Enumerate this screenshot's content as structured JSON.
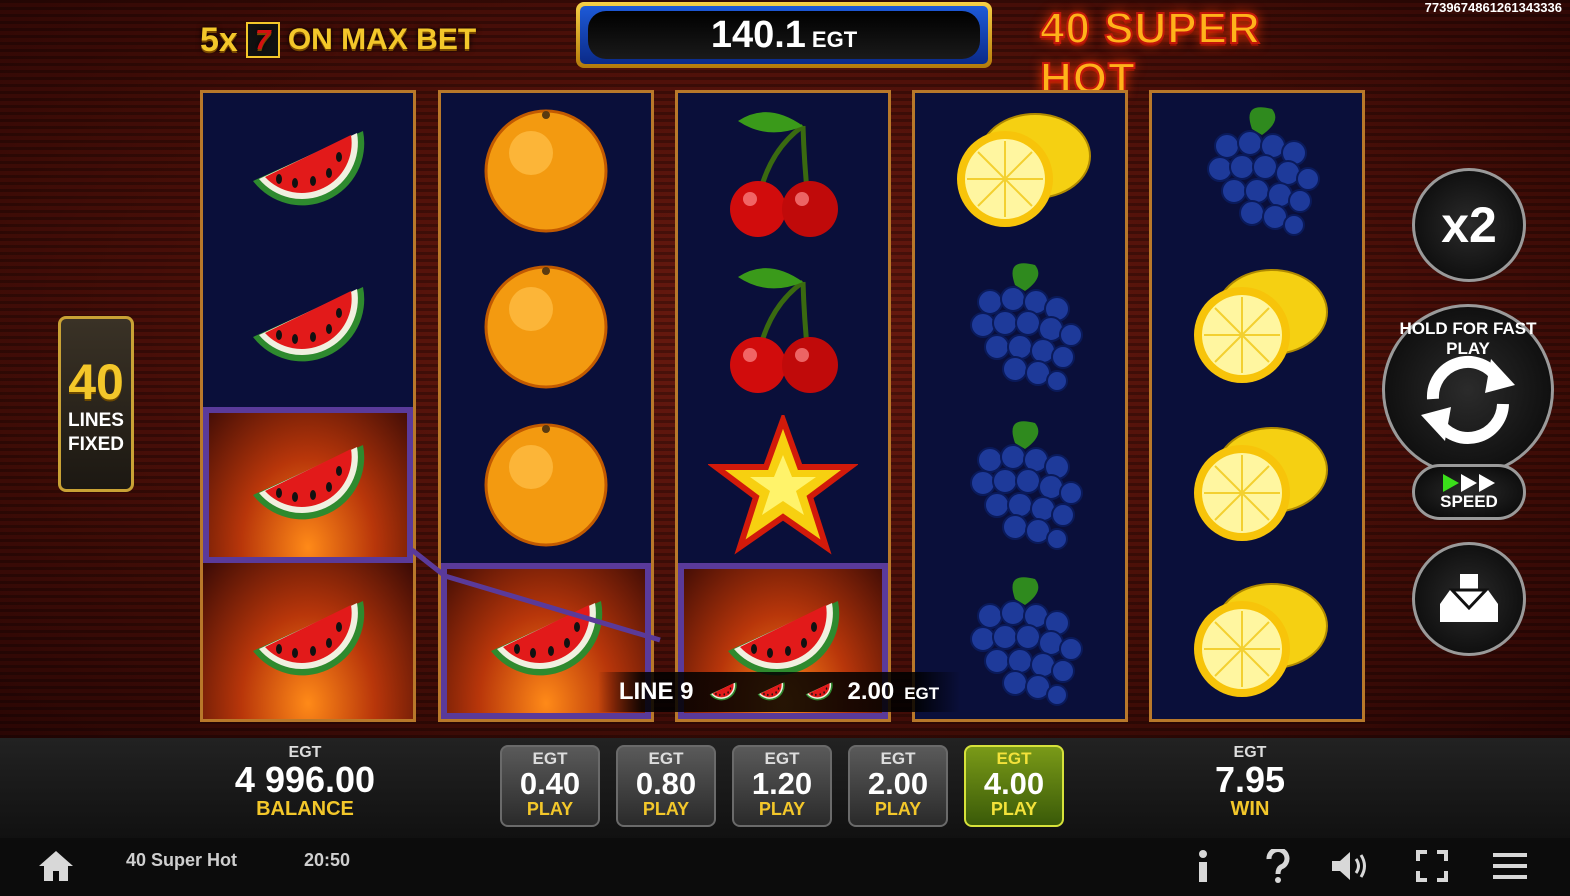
{
  "header": {
    "promo_multiplier": "5x",
    "promo_symbol": "7",
    "promo_text": "ON MAX BET",
    "jackpot_value": "140.1",
    "jackpot_currency": "EGT",
    "game_logo": "40 SUPER HOT",
    "ticket_id": "7739674861261343336"
  },
  "lines_badge": {
    "count": "40",
    "line1": "LINES",
    "line2": "FIXED"
  },
  "reels": [
    [
      "watermelon",
      "watermelon",
      "watermelon",
      "watermelon"
    ],
    [
      "orange",
      "orange",
      "orange",
      "watermelon"
    ],
    [
      "cherry",
      "cherry",
      "star",
      "watermelon"
    ],
    [
      "lemon",
      "grapes",
      "grapes",
      "grapes"
    ],
    [
      "grapes",
      "lemon",
      "lemon",
      "lemon"
    ]
  ],
  "win_line": {
    "label": "LINE 9",
    "symbol": "watermelon",
    "symbol_count": 3,
    "amount": "2.00",
    "currency": "EGT"
  },
  "controls": {
    "multiplier_label": "x2",
    "spin_hint": "HOLD FOR FAST PLAY",
    "speed_label": "SPEED",
    "icons": [
      "refresh-icon",
      "fast-forward-icon",
      "collect-icon"
    ]
  },
  "balance": {
    "currency": "EGT",
    "value": "4 996.00",
    "label": "BALANCE"
  },
  "win": {
    "currency": "EGT",
    "value": "7.95",
    "label": "WIN"
  },
  "bets": [
    {
      "currency": "EGT",
      "value": "0.40",
      "label": "PLAY",
      "selected": false
    },
    {
      "currency": "EGT",
      "value": "0.80",
      "label": "PLAY",
      "selected": false
    },
    {
      "currency": "EGT",
      "value": "1.20",
      "label": "PLAY",
      "selected": false
    },
    {
      "currency": "EGT",
      "value": "2.00",
      "label": "PLAY",
      "selected": false
    },
    {
      "currency": "EGT",
      "value": "4.00",
      "label": "PLAY",
      "selected": true
    }
  ],
  "footer": {
    "game_title": "40 Super Hot",
    "clock": "20:50",
    "icons": [
      "home-icon",
      "info-icon",
      "help-icon",
      "sound-icon",
      "fullscreen-icon",
      "menu-icon"
    ]
  },
  "colors": {
    "accent_gold": "#f3c72a",
    "selected_bet": "#7a9a18",
    "reel_bg": "#0a0f3a"
  }
}
